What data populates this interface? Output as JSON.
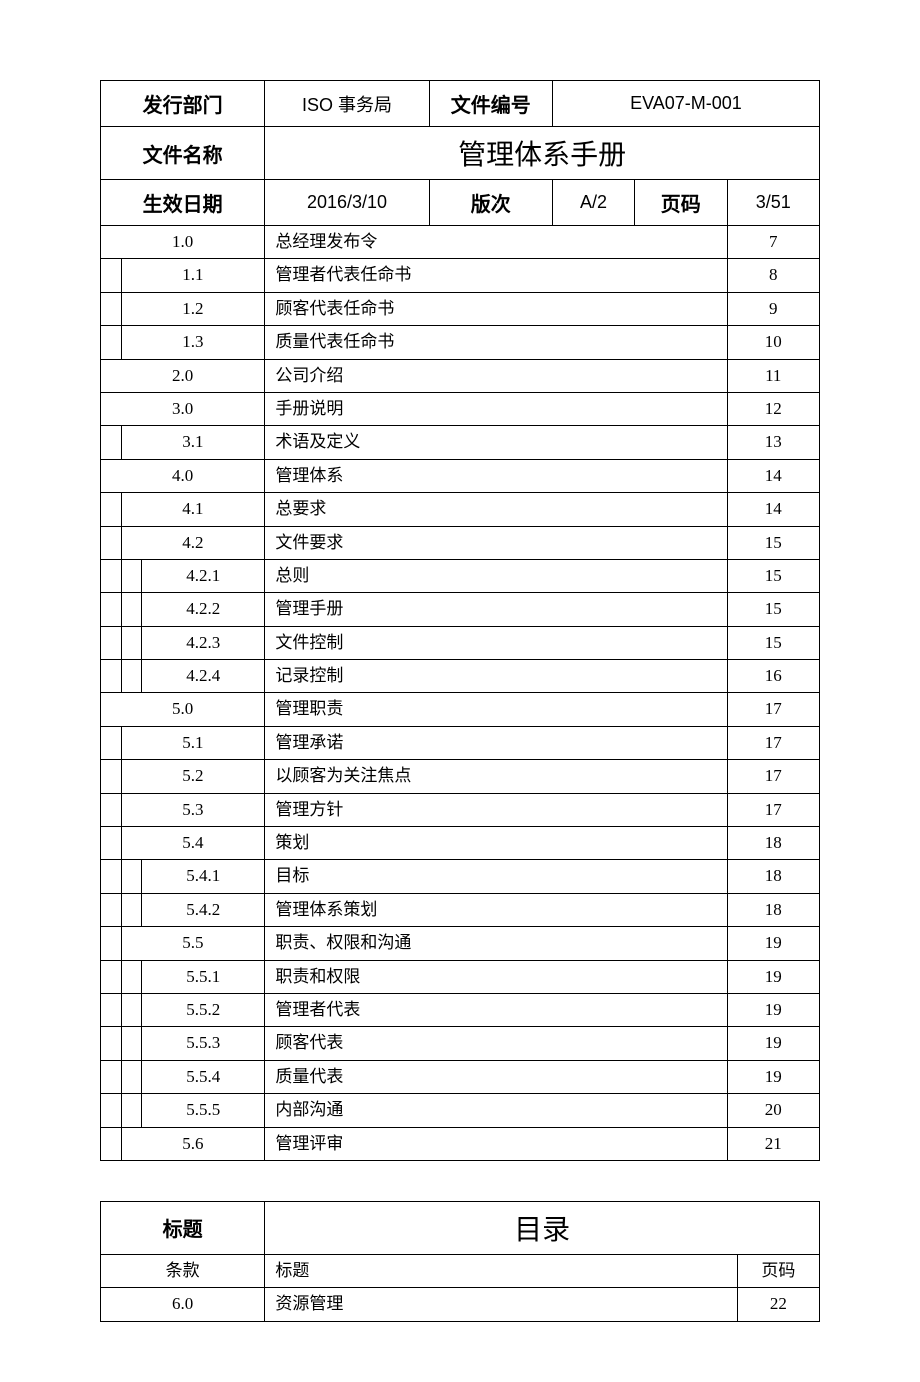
{
  "header": {
    "dept_label": "发行部门",
    "dept_value": "ISO 事务局",
    "docno_label": "文件编号",
    "docno_value": "EVA07-M-001",
    "name_label": "文件名称",
    "name_value": "管理体系手册",
    "date_label": "生效日期",
    "date_value": "2016/3/10",
    "rev_label": "版次",
    "rev_value": "A/2",
    "page_label": "页码",
    "page_value": "3/51"
  },
  "toc": [
    {
      "num": "1.0",
      "indent": 0,
      "title": "总经理发布令",
      "page": "7"
    },
    {
      "num": "1.1",
      "indent": 1,
      "title": "管理者代表任命书",
      "page": "8"
    },
    {
      "num": "1.2",
      "indent": 1,
      "title": "顾客代表任命书",
      "page": "9"
    },
    {
      "num": "1.3",
      "indent": 1,
      "title": "质量代表任命书",
      "page": "10"
    },
    {
      "num": "2.0",
      "indent": 0,
      "title": "公司介绍",
      "page": "11"
    },
    {
      "num": "3.0",
      "indent": 0,
      "title": "手册说明",
      "page": "12"
    },
    {
      "num": "3.1",
      "indent": 1,
      "title": "术语及定义",
      "page": "13"
    },
    {
      "num": "4.0",
      "indent": 0,
      "title": "管理体系",
      "page": "14"
    },
    {
      "num": "4.1",
      "indent": 1,
      "title": "总要求",
      "page": "14"
    },
    {
      "num": "4.2",
      "indent": 1,
      "title": "文件要求",
      "page": "15"
    },
    {
      "num": "4.2.1",
      "indent": 2,
      "title": "总则",
      "page": "15"
    },
    {
      "num": "4.2.2",
      "indent": 2,
      "title": "管理手册",
      "page": "15"
    },
    {
      "num": "4.2.3",
      "indent": 2,
      "title": "文件控制",
      "page": "15"
    },
    {
      "num": "4.2.4",
      "indent": 2,
      "title": "记录控制",
      "page": "16"
    },
    {
      "num": "5.0",
      "indent": 0,
      "title": "管理职责",
      "page": "17"
    },
    {
      "num": "5.1",
      "indent": 1,
      "title": "管理承诺",
      "page": "17"
    },
    {
      "num": "5.2",
      "indent": 1,
      "title": "以顾客为关注焦点",
      "page": "17"
    },
    {
      "num": "5.3",
      "indent": 1,
      "title": "管理方针",
      "page": "17"
    },
    {
      "num": "5.4",
      "indent": 1,
      "title": "策划",
      "page": "18"
    },
    {
      "num": "5.4.1",
      "indent": 2,
      "title": "目标",
      "page": "18"
    },
    {
      "num": "5.4.2",
      "indent": 2,
      "title": "管理体系策划",
      "page": "18"
    },
    {
      "num": "5.5",
      "indent": 1,
      "title": "职责、权限和沟通",
      "page": "19"
    },
    {
      "num": "5.5.1",
      "indent": 2,
      "title": "职责和权限",
      "page": "19"
    },
    {
      "num": "5.5.2",
      "indent": 2,
      "title": "管理者代表",
      "page": "19"
    },
    {
      "num": "5.5.3",
      "indent": 2,
      "title": "顾客代表",
      "page": "19"
    },
    {
      "num": "5.5.4",
      "indent": 2,
      "title": "质量代表",
      "page": "19"
    },
    {
      "num": "5.5.5",
      "indent": 2,
      "title": "内部沟通",
      "page": "20"
    },
    {
      "num": "5.6",
      "indent": 1,
      "title": "管理评审",
      "page": "21"
    }
  ],
  "section2": {
    "header_label": "标题",
    "header_value": "目录",
    "col1": "条款",
    "col2": "标题",
    "col3": "页码",
    "rows": [
      {
        "num": "6.0",
        "title": "资源管理",
        "page": "22"
      }
    ]
  }
}
